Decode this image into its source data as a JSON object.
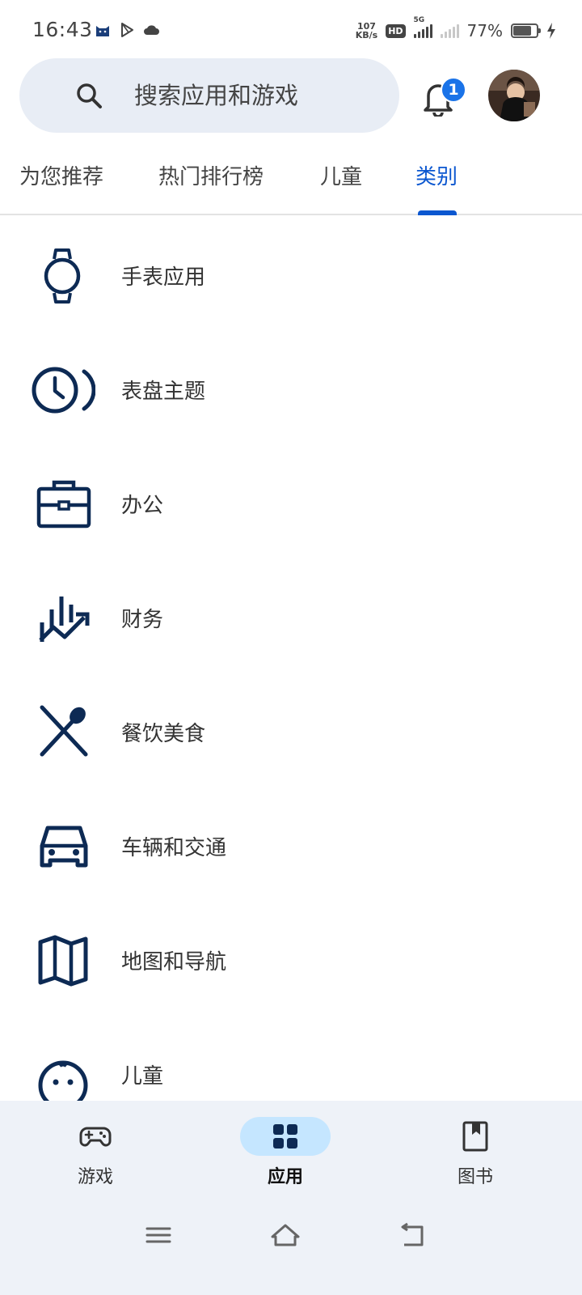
{
  "status_bar": {
    "time": "16:43",
    "net_speed_value": "107",
    "net_speed_unit": "KB/s",
    "hd_label": "HD",
    "network_label": "5G",
    "battery_percent": "77%",
    "battery_level": 0.77
  },
  "header": {
    "search_placeholder": "搜索应用和游戏",
    "notification_count": "1"
  },
  "tabs": [
    {
      "label": "为您推荐",
      "active": false
    },
    {
      "label": "热门排行榜",
      "active": false
    },
    {
      "label": "儿童",
      "active": false
    },
    {
      "label": "类别",
      "active": true
    }
  ],
  "categories": [
    {
      "label": "手表应用",
      "icon": "watch-icon"
    },
    {
      "label": "表盘主题",
      "icon": "watch-face-icon"
    },
    {
      "label": "办公",
      "icon": "briefcase-icon"
    },
    {
      "label": "财务",
      "icon": "finance-chart-icon"
    },
    {
      "label": "餐饮美食",
      "icon": "utensils-icon"
    },
    {
      "label": "车辆和交通",
      "icon": "car-icon"
    },
    {
      "label": "地图和导航",
      "icon": "map-icon"
    },
    {
      "label": "儿童",
      "icon": "kids-icon"
    }
  ],
  "bottom_nav": [
    {
      "label": "游戏",
      "icon": "gamepad-icon",
      "active": false
    },
    {
      "label": "应用",
      "icon": "apps-grid-icon",
      "active": true
    },
    {
      "label": "图书",
      "icon": "book-icon",
      "active": false
    }
  ],
  "colors": {
    "accent": "#0b57d0",
    "icon_navy": "#0d2a54",
    "nav_background": "#eef2f8",
    "active_pill": "#c5e6ff",
    "search_background": "#e8edf5"
  }
}
